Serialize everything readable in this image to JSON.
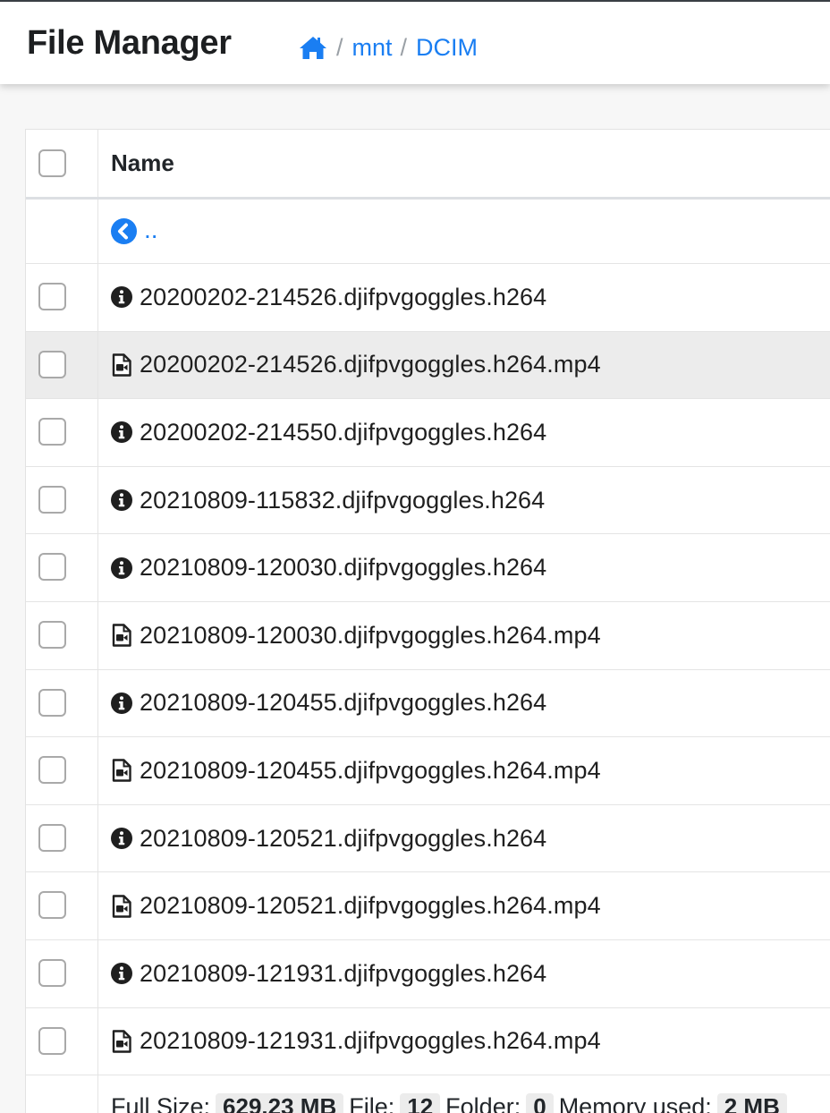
{
  "header": {
    "app_title": "File Manager",
    "breadcrumb": [
      "mnt",
      "DCIM"
    ],
    "home_icon": "home-icon",
    "separator": "/"
  },
  "table": {
    "column_name": "Name",
    "parent_link": "..",
    "files": [
      {
        "name": "20200202-214526.djifpvgoggles.h264",
        "icon": "info-circle-icon"
      },
      {
        "name": "20200202-214526.djifpvgoggles.h264.mp4",
        "icon": "file-video-icon"
      },
      {
        "name": "20200202-214550.djifpvgoggles.h264",
        "icon": "info-circle-icon"
      },
      {
        "name": "20210809-115832.djifpvgoggles.h264",
        "icon": "info-circle-icon"
      },
      {
        "name": "20210809-120030.djifpvgoggles.h264",
        "icon": "info-circle-icon"
      },
      {
        "name": "20210809-120030.djifpvgoggles.h264.mp4",
        "icon": "file-video-icon"
      },
      {
        "name": "20210809-120455.djifpvgoggles.h264",
        "icon": "info-circle-icon"
      },
      {
        "name": "20210809-120455.djifpvgoggles.h264.mp4",
        "icon": "file-video-icon"
      },
      {
        "name": "20210809-120521.djifpvgoggles.h264",
        "icon": "info-circle-icon"
      },
      {
        "name": "20210809-120521.djifpvgoggles.h264.mp4",
        "icon": "file-video-icon"
      },
      {
        "name": "20210809-121931.djifpvgoggles.h264",
        "icon": "info-circle-icon"
      },
      {
        "name": "20210809-121931.djifpvgoggles.h264.mp4",
        "icon": "file-video-icon"
      }
    ]
  },
  "footer": {
    "full_size_label": "Full Size:",
    "full_size_value": "629.23 MB",
    "file_label": "File:",
    "file_count": "12",
    "folder_label": "Folder:",
    "folder_count": "0",
    "memory_label": "Memory used:",
    "memory_value": "2 MB"
  },
  "colors": {
    "link": "#1a7ef2",
    "highlight_row": "#ececec"
  }
}
